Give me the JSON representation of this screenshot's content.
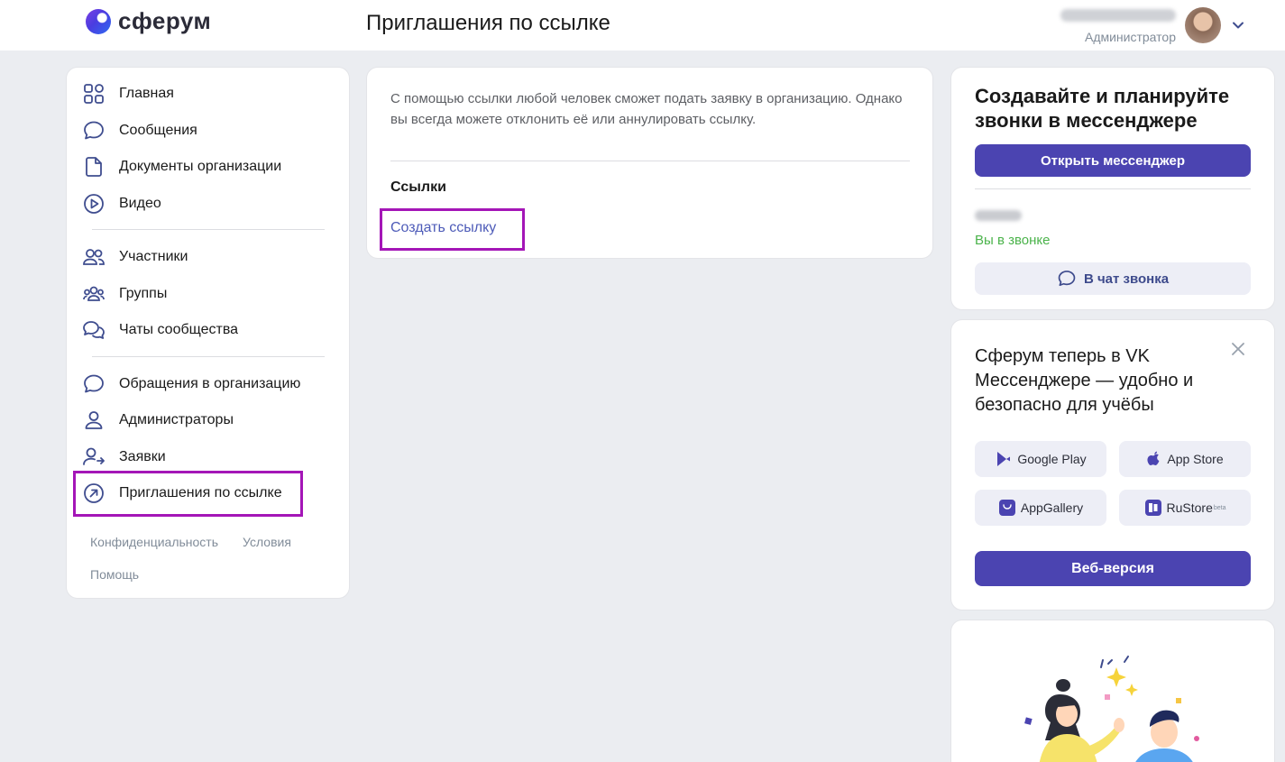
{
  "header": {
    "logo_text": "сферум",
    "page_title": "Приглашения по ссылке",
    "user_role": "Администратор"
  },
  "sidebar": {
    "items": [
      {
        "label": "Главная",
        "icon": "grid-icon"
      },
      {
        "label": "Сообщения",
        "icon": "message-icon"
      },
      {
        "label": "Документы организации",
        "icon": "document-icon"
      },
      {
        "label": "Видео",
        "icon": "play-icon"
      },
      {
        "label": "Участники",
        "icon": "users-icon"
      },
      {
        "label": "Группы",
        "icon": "groups-icon"
      },
      {
        "label": "Чаты сообщества",
        "icon": "chats-icon"
      },
      {
        "label": "Обращения в организацию",
        "icon": "message-icon"
      },
      {
        "label": "Администраторы",
        "icon": "user-icon"
      },
      {
        "label": "Заявки",
        "icon": "user-arrow-icon"
      },
      {
        "label": "Приглашения по ссылке",
        "icon": "arrow-circle-icon",
        "active": true
      }
    ],
    "footer": {
      "privacy": "Конфиденциальность",
      "terms": "Условия",
      "help": "Помощь"
    }
  },
  "main": {
    "description": "С помощью ссылки любой человек сможет подать заявку в организацию. Однако вы всегда можете отклонить её или аннулировать ссылку.",
    "links_title": "Ссылки",
    "create_link": "Создать ссылку"
  },
  "calls_card": {
    "title": "Создавайте и планируйте звонки в мессенджере",
    "open_button": "Открыть мессенджер",
    "status": "Вы в звонке",
    "chat_button": "В чат звонка"
  },
  "promo_card": {
    "title": "Сферум теперь в VK Мессенджере — удобно и безопасно для учёбы",
    "stores": {
      "google_play": "Google Play",
      "app_store": "App Store",
      "app_gallery": "AppGallery",
      "rustore": "RuStore",
      "rustore_badge": "beta"
    },
    "web_button": "Веб-версия"
  },
  "colors": {
    "accent": "#4b44b1",
    "highlight": "#a416b7",
    "link": "#4d5bb8",
    "status_green": "#4bb34b"
  }
}
